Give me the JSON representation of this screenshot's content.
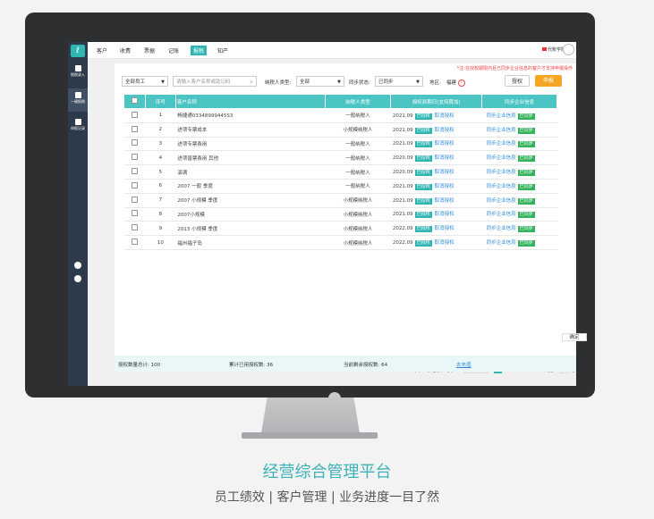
{
  "sidebar": {
    "logo": "ℓ",
    "items": [
      {
        "label": "税税录入",
        "icon": "entry-icon"
      },
      {
        "label": "一键报税",
        "icon": "tax-icon"
      },
      {
        "label": "申报记录",
        "icon": "record-icon"
      }
    ],
    "bottom_icons": [
      "phone-icon",
      "settings-icon"
    ]
  },
  "topnav": {
    "items": [
      "客户",
      "收费",
      "票据",
      "记账",
      "报税",
      "知产"
    ],
    "active": "报税",
    "brand": "代账学院"
  },
  "notice": "*注:在授权期限内且已同步企业信息的客户才支持申报操作",
  "filters": {
    "employee": "全部员工",
    "search_placeholder": "请输入客户名称或助记码",
    "taxpayer_type_label": "纳税人类型:",
    "taxpayer_type": "全部",
    "sync_status_label": "同步状态:",
    "sync_status": "已同步",
    "region_label": "地区:",
    "region": "福建",
    "auth_button": "授权",
    "declare_button": "申报"
  },
  "table": {
    "headers": [
      "",
      "序号",
      "客户名称",
      "纳税人类型",
      "授权到期日(支持算加)",
      "同步企业信息"
    ],
    "rows": [
      {
        "no": "1",
        "name": "畅捷通03348999445S3",
        "type": "一般纳税人",
        "date": "2021.09",
        "authorized": "已授权",
        "cancel": "取消授权",
        "sync": "同步企业信息",
        "synced": "已同步"
      },
      {
        "no": "2",
        "name": "进项专票成本",
        "type": "小规模纳税人",
        "date": "2021.09",
        "authorized": "已授权",
        "cancel": "取消授权",
        "sync": "同步企业信息",
        "synced": "已同步"
      },
      {
        "no": "3",
        "name": "进项专票费用",
        "type": "一般纳税人",
        "date": "2021.09",
        "authorized": "已授权",
        "cancel": "取消授权",
        "sync": "同步企业信息",
        "synced": "已同步"
      },
      {
        "no": "4",
        "name": "进项普票费用 其他",
        "type": "一般纳税人",
        "date": "2020.09",
        "authorized": "已授权",
        "cancel": "取消授权",
        "sync": "同步企业信息",
        "synced": "已同步"
      },
      {
        "no": "5",
        "name": "演满",
        "type": "一般纳税人",
        "date": "2020.09",
        "authorized": "已授权",
        "cancel": "取消授权",
        "sync": "同步企业信息",
        "synced": "已同步"
      },
      {
        "no": "6",
        "name": "2007 一般 季度",
        "type": "一般纳税人",
        "date": "2021.09",
        "authorized": "已授权",
        "cancel": "取消授权",
        "sync": "同步企业信息",
        "synced": "已同步"
      },
      {
        "no": "7",
        "name": "2007 小规模 季度",
        "type": "小规模纳税人",
        "date": "2021.09",
        "authorized": "已授权",
        "cancel": "取消授权",
        "sync": "同步企业信息",
        "synced": "已同步"
      },
      {
        "no": "8",
        "name": "2007小规模",
        "type": "小规模纳税人",
        "date": "2021.09",
        "authorized": "已授权",
        "cancel": "取消授权",
        "sync": "同步企业信息",
        "synced": "已同步"
      },
      {
        "no": "9",
        "name": "2013 小规模 季度",
        "type": "小规模纳税人",
        "date": "2022.09",
        "authorized": "已授权",
        "cancel": "取消授权",
        "sync": "同步企业信息",
        "synced": "已同步"
      },
      {
        "no": "10",
        "name": "福州福子岛",
        "type": "小规模纳税人",
        "date": "2022.09",
        "authorized": "已授权",
        "cancel": "取消授权",
        "sync": "同步企业信息",
        "synced": "已同步"
      }
    ]
  },
  "pagination": {
    "summary": "共16条记录, 2页",
    "prev": "上一页",
    "page1": "1",
    "page2": "2",
    "next": "下一页",
    "goto_label": "到第",
    "goto_value": "1",
    "page_unit": "页",
    "confirm": "确定"
  },
  "footer": {
    "total": "授权数量总计: 100",
    "used": "累计已用授权数: 36",
    "remaining": "当前剩余授权数: 64",
    "more": "去充值"
  },
  "caption": {
    "title": "经营综合管理平台",
    "subtitle": "员工绩效 | 客户管理 | 业务进度一目了然"
  },
  "colors": {
    "accent": "#2fb6b2",
    "header": "#4bc4c4",
    "orange": "#f5a623",
    "sidebar": "#2c3a4b"
  }
}
